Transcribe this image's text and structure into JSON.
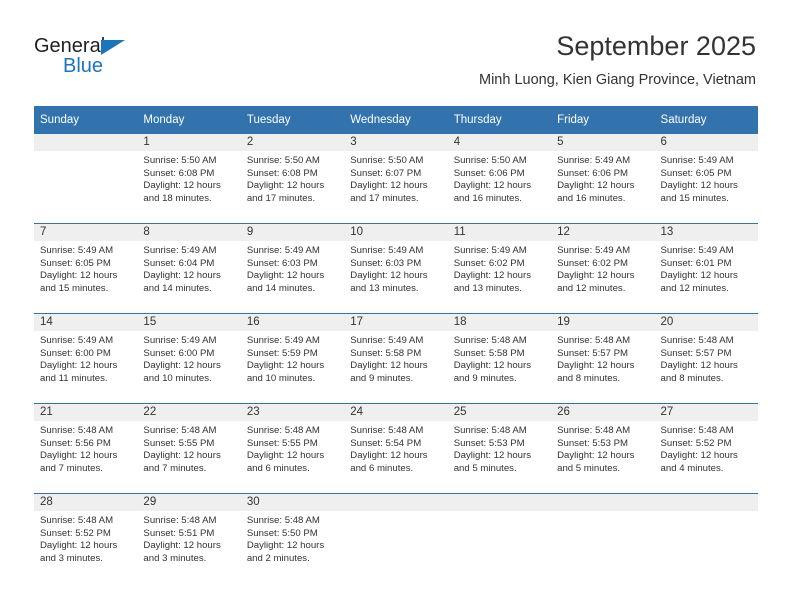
{
  "brand": {
    "name_part1": "General",
    "name_part2": "Blue",
    "triangle_icon": "triangle-icon",
    "color_dark": "#231f20",
    "color_blue": "#1b75bb"
  },
  "header": {
    "month_title": "September 2025",
    "location": "Minh Luong, Kien Giang Province, Vietnam"
  },
  "theme": {
    "header_blue": "#3273ae",
    "daynum_band": "#efefef",
    "text": "#333333"
  },
  "weekday_headers": [
    "Sunday",
    "Monday",
    "Tuesday",
    "Wednesday",
    "Thursday",
    "Friday",
    "Saturday"
  ],
  "weeks": [
    [
      {
        "day": "",
        "sunrise": "",
        "sunset": "",
        "daylight1": "",
        "daylight2": ""
      },
      {
        "day": "1",
        "sunrise": "Sunrise: 5:50 AM",
        "sunset": "Sunset: 6:08 PM",
        "daylight1": "Daylight: 12 hours",
        "daylight2": "and 18 minutes."
      },
      {
        "day": "2",
        "sunrise": "Sunrise: 5:50 AM",
        "sunset": "Sunset: 6:08 PM",
        "daylight1": "Daylight: 12 hours",
        "daylight2": "and 17 minutes."
      },
      {
        "day": "3",
        "sunrise": "Sunrise: 5:50 AM",
        "sunset": "Sunset: 6:07 PM",
        "daylight1": "Daylight: 12 hours",
        "daylight2": "and 17 minutes."
      },
      {
        "day": "4",
        "sunrise": "Sunrise: 5:50 AM",
        "sunset": "Sunset: 6:06 PM",
        "daylight1": "Daylight: 12 hours",
        "daylight2": "and 16 minutes."
      },
      {
        "day": "5",
        "sunrise": "Sunrise: 5:49 AM",
        "sunset": "Sunset: 6:06 PM",
        "daylight1": "Daylight: 12 hours",
        "daylight2": "and 16 minutes."
      },
      {
        "day": "6",
        "sunrise": "Sunrise: 5:49 AM",
        "sunset": "Sunset: 6:05 PM",
        "daylight1": "Daylight: 12 hours",
        "daylight2": "and 15 minutes."
      }
    ],
    [
      {
        "day": "7",
        "sunrise": "Sunrise: 5:49 AM",
        "sunset": "Sunset: 6:05 PM",
        "daylight1": "Daylight: 12 hours",
        "daylight2": "and 15 minutes."
      },
      {
        "day": "8",
        "sunrise": "Sunrise: 5:49 AM",
        "sunset": "Sunset: 6:04 PM",
        "daylight1": "Daylight: 12 hours",
        "daylight2": "and 14 minutes."
      },
      {
        "day": "9",
        "sunrise": "Sunrise: 5:49 AM",
        "sunset": "Sunset: 6:03 PM",
        "daylight1": "Daylight: 12 hours",
        "daylight2": "and 14 minutes."
      },
      {
        "day": "10",
        "sunrise": "Sunrise: 5:49 AM",
        "sunset": "Sunset: 6:03 PM",
        "daylight1": "Daylight: 12 hours",
        "daylight2": "and 13 minutes."
      },
      {
        "day": "11",
        "sunrise": "Sunrise: 5:49 AM",
        "sunset": "Sunset: 6:02 PM",
        "daylight1": "Daylight: 12 hours",
        "daylight2": "and 13 minutes."
      },
      {
        "day": "12",
        "sunrise": "Sunrise: 5:49 AM",
        "sunset": "Sunset: 6:02 PM",
        "daylight1": "Daylight: 12 hours",
        "daylight2": "and 12 minutes."
      },
      {
        "day": "13",
        "sunrise": "Sunrise: 5:49 AM",
        "sunset": "Sunset: 6:01 PM",
        "daylight1": "Daylight: 12 hours",
        "daylight2": "and 12 minutes."
      }
    ],
    [
      {
        "day": "14",
        "sunrise": "Sunrise: 5:49 AM",
        "sunset": "Sunset: 6:00 PM",
        "daylight1": "Daylight: 12 hours",
        "daylight2": "and 11 minutes."
      },
      {
        "day": "15",
        "sunrise": "Sunrise: 5:49 AM",
        "sunset": "Sunset: 6:00 PM",
        "daylight1": "Daylight: 12 hours",
        "daylight2": "and 10 minutes."
      },
      {
        "day": "16",
        "sunrise": "Sunrise: 5:49 AM",
        "sunset": "Sunset: 5:59 PM",
        "daylight1": "Daylight: 12 hours",
        "daylight2": "and 10 minutes."
      },
      {
        "day": "17",
        "sunrise": "Sunrise: 5:49 AM",
        "sunset": "Sunset: 5:58 PM",
        "daylight1": "Daylight: 12 hours",
        "daylight2": "and 9 minutes."
      },
      {
        "day": "18",
        "sunrise": "Sunrise: 5:48 AM",
        "sunset": "Sunset: 5:58 PM",
        "daylight1": "Daylight: 12 hours",
        "daylight2": "and 9 minutes."
      },
      {
        "day": "19",
        "sunrise": "Sunrise: 5:48 AM",
        "sunset": "Sunset: 5:57 PM",
        "daylight1": "Daylight: 12 hours",
        "daylight2": "and 8 minutes."
      },
      {
        "day": "20",
        "sunrise": "Sunrise: 5:48 AM",
        "sunset": "Sunset: 5:57 PM",
        "daylight1": "Daylight: 12 hours",
        "daylight2": "and 8 minutes."
      }
    ],
    [
      {
        "day": "21",
        "sunrise": "Sunrise: 5:48 AM",
        "sunset": "Sunset: 5:56 PM",
        "daylight1": "Daylight: 12 hours",
        "daylight2": "and 7 minutes."
      },
      {
        "day": "22",
        "sunrise": "Sunrise: 5:48 AM",
        "sunset": "Sunset: 5:55 PM",
        "daylight1": "Daylight: 12 hours",
        "daylight2": "and 7 minutes."
      },
      {
        "day": "23",
        "sunrise": "Sunrise: 5:48 AM",
        "sunset": "Sunset: 5:55 PM",
        "daylight1": "Daylight: 12 hours",
        "daylight2": "and 6 minutes."
      },
      {
        "day": "24",
        "sunrise": "Sunrise: 5:48 AM",
        "sunset": "Sunset: 5:54 PM",
        "daylight1": "Daylight: 12 hours",
        "daylight2": "and 6 minutes."
      },
      {
        "day": "25",
        "sunrise": "Sunrise: 5:48 AM",
        "sunset": "Sunset: 5:53 PM",
        "daylight1": "Daylight: 12 hours",
        "daylight2": "and 5 minutes."
      },
      {
        "day": "26",
        "sunrise": "Sunrise: 5:48 AM",
        "sunset": "Sunset: 5:53 PM",
        "daylight1": "Daylight: 12 hours",
        "daylight2": "and 5 minutes."
      },
      {
        "day": "27",
        "sunrise": "Sunrise: 5:48 AM",
        "sunset": "Sunset: 5:52 PM",
        "daylight1": "Daylight: 12 hours",
        "daylight2": "and 4 minutes."
      }
    ],
    [
      {
        "day": "28",
        "sunrise": "Sunrise: 5:48 AM",
        "sunset": "Sunset: 5:52 PM",
        "daylight1": "Daylight: 12 hours",
        "daylight2": "and 3 minutes."
      },
      {
        "day": "29",
        "sunrise": "Sunrise: 5:48 AM",
        "sunset": "Sunset: 5:51 PM",
        "daylight1": "Daylight: 12 hours",
        "daylight2": "and 3 minutes."
      },
      {
        "day": "30",
        "sunrise": "Sunrise: 5:48 AM",
        "sunset": "Sunset: 5:50 PM",
        "daylight1": "Daylight: 12 hours",
        "daylight2": "and 2 minutes."
      },
      {
        "day": "",
        "sunrise": "",
        "sunset": "",
        "daylight1": "",
        "daylight2": ""
      },
      {
        "day": "",
        "sunrise": "",
        "sunset": "",
        "daylight1": "",
        "daylight2": ""
      },
      {
        "day": "",
        "sunrise": "",
        "sunset": "",
        "daylight1": "",
        "daylight2": ""
      },
      {
        "day": "",
        "sunrise": "",
        "sunset": "",
        "daylight1": "",
        "daylight2": ""
      }
    ]
  ]
}
